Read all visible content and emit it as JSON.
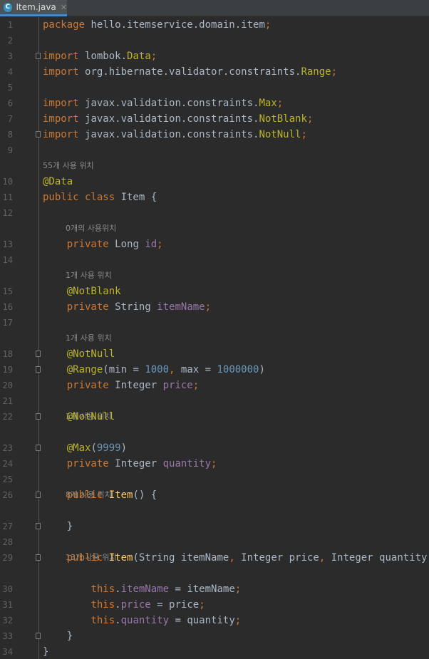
{
  "tab": {
    "icon_letter": "C",
    "filename": "Item.java",
    "close_glyph": "✕"
  },
  "usage_hints": {
    "class_hint": "55개 사용 위치",
    "id_hint": "0개의 사용위치",
    "itemName_hint": "1개 사용 위치",
    "price_hint": "1개 사용 위치",
    "quantity_hint": "1개 사용 위치",
    "ctor_default_hint": "8개 사용 위치",
    "ctor_args_hint": "13개 사용 위치"
  },
  "lines": [
    {
      "n": "1",
      "tokens": [
        [
          "kw",
          "package "
        ],
        [
          "pl",
          "hello.itemservice.domain.item"
        ],
        [
          "kw",
          ";"
        ]
      ]
    },
    {
      "n": "2",
      "tokens": []
    },
    {
      "n": "3",
      "tokens": [
        [
          "kw",
          "import "
        ],
        [
          "pl",
          "lombok."
        ],
        [
          "ann",
          "Data"
        ],
        [
          "kw",
          ";"
        ]
      ]
    },
    {
      "n": "4",
      "tokens": [
        [
          "kw",
          "import "
        ],
        [
          "pl",
          "org.hibernate.validator.constraints."
        ],
        [
          "ann",
          "Range"
        ],
        [
          "kw",
          ";"
        ]
      ]
    },
    {
      "n": "5",
      "tokens": []
    },
    {
      "n": "6",
      "tokens": [
        [
          "kw",
          "import "
        ],
        [
          "pl",
          "javax.validation.constraints."
        ],
        [
          "ann",
          "Max"
        ],
        [
          "kw",
          ";"
        ]
      ]
    },
    {
      "n": "7",
      "tokens": [
        [
          "kw",
          "import "
        ],
        [
          "pl",
          "javax.validation.constraints."
        ],
        [
          "ann",
          "NotBlank"
        ],
        [
          "kw",
          ";"
        ]
      ]
    },
    {
      "n": "8",
      "tokens": [
        [
          "kw",
          "import "
        ],
        [
          "pl",
          "javax.validation.constraints."
        ],
        [
          "ann",
          "NotNull"
        ],
        [
          "kw",
          ";"
        ]
      ]
    },
    {
      "n": "9",
      "tokens": []
    },
    {
      "n": "10",
      "tokens": [
        [
          "ann",
          "@Data"
        ]
      ]
    },
    {
      "n": "11",
      "tokens": [
        [
          "kw",
          "public class "
        ],
        [
          "pl",
          "Item {"
        ]
      ]
    },
    {
      "n": "12",
      "tokens": []
    },
    {
      "n": "13",
      "tokens": [
        [
          "pl",
          "    "
        ],
        [
          "kw",
          "private "
        ],
        [
          "pl",
          "Long "
        ],
        [
          "fld",
          "id"
        ],
        [
          "kw",
          ";"
        ]
      ]
    },
    {
      "n": "14",
      "tokens": []
    },
    {
      "n": "15",
      "tokens": [
        [
          "pl",
          "    "
        ],
        [
          "ann",
          "@NotBlank"
        ]
      ]
    },
    {
      "n": "16",
      "tokens": [
        [
          "pl",
          "    "
        ],
        [
          "kw",
          "private "
        ],
        [
          "pl",
          "String "
        ],
        [
          "fld",
          "itemName"
        ],
        [
          "kw",
          ";"
        ]
      ]
    },
    {
      "n": "17",
      "tokens": []
    },
    {
      "n": "18",
      "tokens": [
        [
          "pl",
          "    "
        ],
        [
          "ann",
          "@NotNull"
        ]
      ]
    },
    {
      "n": "19",
      "tokens": [
        [
          "pl",
          "    "
        ],
        [
          "ann",
          "@Range"
        ],
        [
          "pl",
          "(min = "
        ],
        [
          "num",
          "1000"
        ],
        [
          "kw",
          ", "
        ],
        [
          "pl",
          "max = "
        ],
        [
          "num",
          "1000000"
        ],
        [
          "pl",
          ")"
        ]
      ]
    },
    {
      "n": "20",
      "tokens": [
        [
          "pl",
          "    "
        ],
        [
          "kw",
          "private "
        ],
        [
          "pl",
          "Integer "
        ],
        [
          "fld",
          "price"
        ],
        [
          "kw",
          ";"
        ]
      ]
    },
    {
      "n": "21",
      "tokens": []
    },
    {
      "n": "22",
      "tokens": [
        [
          "pl",
          "    "
        ],
        [
          "ann",
          "@NotNull"
        ]
      ]
    },
    {
      "n": "23",
      "tokens": [
        [
          "pl",
          "    "
        ],
        [
          "ann",
          "@Max"
        ],
        [
          "pl",
          "("
        ],
        [
          "num",
          "9999"
        ],
        [
          "pl",
          ")"
        ]
      ]
    },
    {
      "n": "24",
      "tokens": [
        [
          "pl",
          "    "
        ],
        [
          "kw",
          "private "
        ],
        [
          "pl",
          "Integer "
        ],
        [
          "fld",
          "quantity"
        ],
        [
          "kw",
          ";"
        ]
      ]
    },
    {
      "n": "25",
      "tokens": []
    },
    {
      "n": "26",
      "tokens": [
        [
          "pl",
          "    "
        ],
        [
          "kw",
          "public "
        ],
        [
          "mth",
          "Item"
        ],
        [
          "pl",
          "() {"
        ]
      ]
    },
    {
      "n": "27",
      "tokens": [
        [
          "pl",
          "    }"
        ]
      ]
    },
    {
      "n": "28",
      "tokens": []
    },
    {
      "n": "29",
      "tokens": [
        [
          "pl",
          "    "
        ],
        [
          "kw",
          "public "
        ],
        [
          "mth",
          "Item"
        ],
        [
          "pl",
          "(String itemName"
        ],
        [
          "kw",
          ", "
        ],
        [
          "pl",
          "Integer price"
        ],
        [
          "kw",
          ", "
        ],
        [
          "pl",
          "Integer quantity) {"
        ]
      ]
    },
    {
      "n": "30",
      "tokens": [
        [
          "pl",
          "        "
        ],
        [
          "kw",
          "this"
        ],
        [
          "pl",
          "."
        ],
        [
          "fld",
          "itemName"
        ],
        [
          "pl",
          " = itemName"
        ],
        [
          "kw",
          ";"
        ]
      ]
    },
    {
      "n": "31",
      "tokens": [
        [
          "pl",
          "        "
        ],
        [
          "kw",
          "this"
        ],
        [
          "pl",
          "."
        ],
        [
          "fld",
          "price"
        ],
        [
          "pl",
          " = price"
        ],
        [
          "kw",
          ";"
        ]
      ]
    },
    {
      "n": "32",
      "tokens": [
        [
          "pl",
          "        "
        ],
        [
          "kw",
          "this"
        ],
        [
          "pl",
          "."
        ],
        [
          "fld",
          "quantity"
        ],
        [
          "pl",
          " = quantity"
        ],
        [
          "kw",
          ";"
        ]
      ]
    },
    {
      "n": "33",
      "tokens": [
        [
          "pl",
          "    }"
        ]
      ]
    },
    {
      "n": "34",
      "tokens": [
        [
          "pl",
          "}"
        ]
      ]
    }
  ],
  "colors": {
    "background": "#2b2b2b",
    "keyword": "#cc7832",
    "annotation": "#bbb529",
    "field": "#9876aa",
    "number": "#6897bb",
    "method": "#ffc66d",
    "text": "#a9b7c6",
    "line_number": "#606366"
  }
}
